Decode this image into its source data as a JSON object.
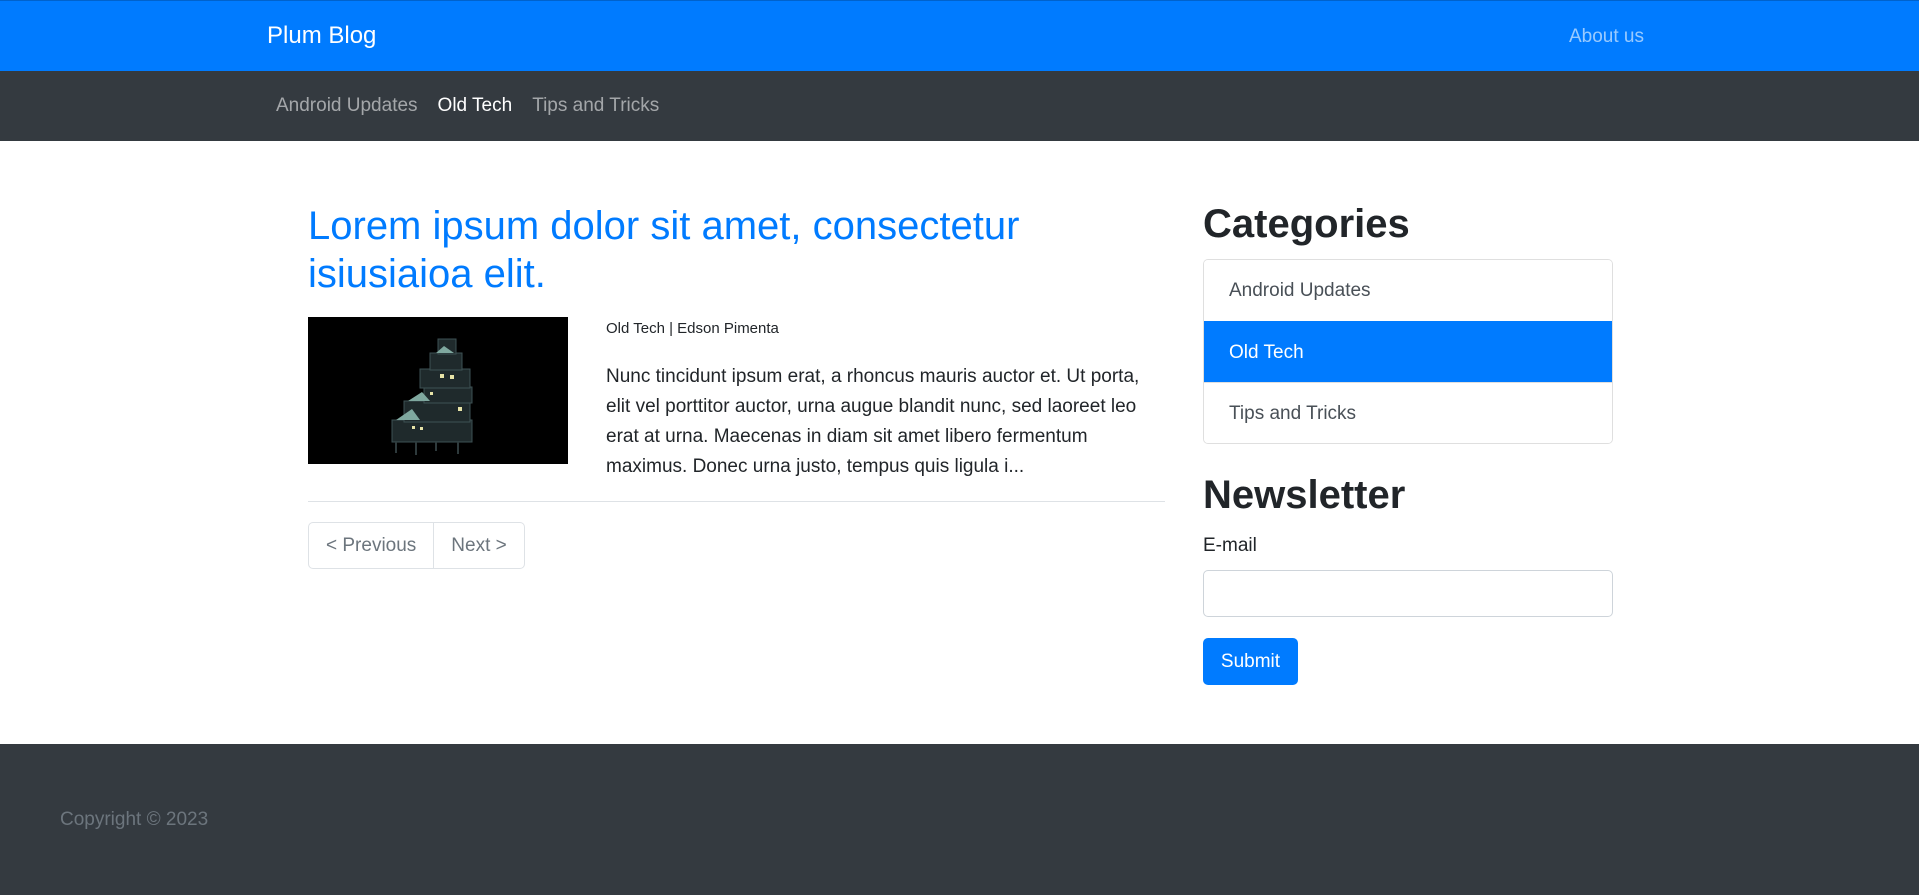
{
  "header": {
    "brand": "Plum Blog",
    "about_link": "About us"
  },
  "category_nav": {
    "items": [
      {
        "label": "Android Updates",
        "active": false
      },
      {
        "label": "Old Tech",
        "active": true
      },
      {
        "label": "Tips and Tricks",
        "active": false
      }
    ]
  },
  "post": {
    "title": "Lorem ipsum dolor sit amet, consectetur isiusiaioa elit.",
    "meta": "Old Tech | Edson Pimenta",
    "excerpt": "Nunc tincidunt ipsum erat, a rhoncus mauris auctor et. Ut porta, elit vel porttitor auctor, urna augue blandit nunc, sed laoreet leo erat at urna. Maecenas in diam sit amet libero fermentum maximus. Donec urna justo, tempus quis ligula i...",
    "thumbnail_icon": "building-at-night-image"
  },
  "pagination": {
    "previous_label": "< Previous",
    "next_label": "Next >"
  },
  "sidebar": {
    "categories_title": "Categories",
    "categories": [
      {
        "label": "Android Updates",
        "active": false
      },
      {
        "label": "Old Tech",
        "active": true
      },
      {
        "label": "Tips and Tricks",
        "active": false
      }
    ],
    "newsletter_title": "Newsletter",
    "email_label": "E-mail",
    "email_value": "",
    "submit_label": "Submit"
  },
  "footer": {
    "copyright": "Copyright © 2023"
  },
  "colors": {
    "primary": "#007bff",
    "dark": "#343a40",
    "muted": "#6c757d"
  }
}
